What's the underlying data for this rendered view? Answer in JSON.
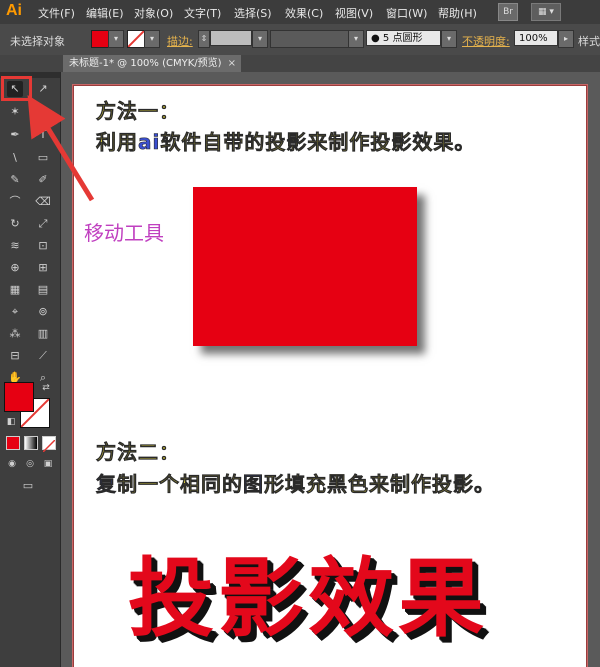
{
  "app": {
    "logo": "Ai",
    "br_badge": "Br",
    "workspace_glyph": "▦ ▾"
  },
  "menu": [
    "文件(F)",
    "编辑(E)",
    "对象(O)",
    "文字(T)",
    "选择(S)",
    "效果(C)",
    "视图(V)",
    "窗口(W)",
    "帮助(H)"
  ],
  "control_bar": {
    "no_selection": "未选择对象",
    "stroke_label": "描边:",
    "brush_value": "5 点圆形",
    "opacity_label": "不透明度:",
    "opacity_value": "100%",
    "style_label": "样式",
    "fill_color": "#e60012"
  },
  "tab": {
    "title": "未标题-1* @ 100% (CMYK/预览)",
    "close": "×"
  },
  "tools": {
    "selection": "↖",
    "direct": "↗",
    "wand": "✶",
    "lasso": "ℓ",
    "pen": "✒",
    "type": "T",
    "line": "\\",
    "rect": "▭",
    "brush": "✎",
    "pencil": "✐",
    "blob": "⌒",
    "eraser": "⌫",
    "rotate": "↻",
    "scale": "⤢",
    "warp": "≋",
    "free_transform": "⊡",
    "shape_builder": "⊕",
    "perspective": "⊞",
    "mesh": "▦",
    "gradient": "▤",
    "eyedropper": "⌖",
    "blend": "⊚",
    "symbol": "⁂",
    "graph": "▥",
    "artboard": "⊟",
    "slice": "⟋",
    "hand": "✋",
    "zoom": "⌕",
    "screen_mode": "▭"
  },
  "colors": {
    "fill": "#e60012",
    "stroke": "#ffffff",
    "accent_red": "#e53935"
  },
  "annotation": {
    "label": "移动工具"
  },
  "artboard": {
    "method1_title": "方法一：",
    "method1_desc_a": "利用",
    "method1_desc_b": "ai",
    "method1_desc_c": "软件自带的投影来制作投影效果。",
    "method2_title": "方法二：",
    "method2_desc_a": "复",
    "method2_desc_b": "制一个相同的",
    "method2_desc_c": "图",
    "method2_desc_d": "形填充黑色来制作投影。",
    "big_text": "投影效果"
  }
}
